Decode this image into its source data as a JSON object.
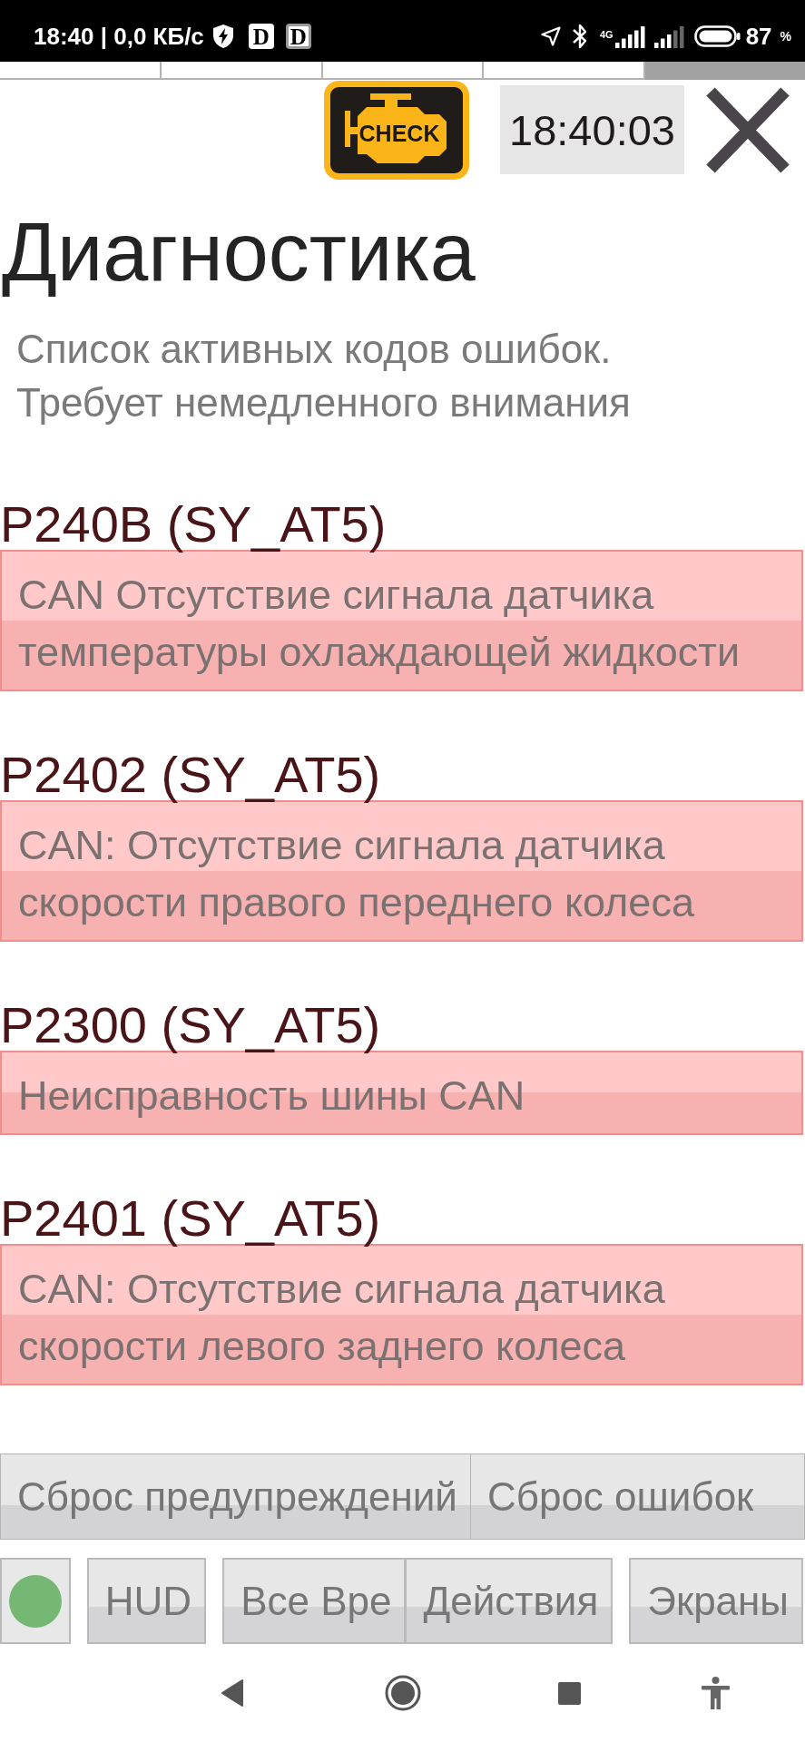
{
  "status_bar": {
    "time_and_speed": "18:40 | 0,0 КБ/с",
    "app_logos": [
      "D",
      "D"
    ],
    "network_type": "4G",
    "battery": "87",
    "battery_unit": "%"
  },
  "pager": [
    {
      "selected": false
    },
    {
      "selected": false
    },
    {
      "selected": false
    },
    {
      "selected": false
    },
    {
      "selected": true
    }
  ],
  "toolbar": {
    "check_engine": {
      "label": "CHECK"
    },
    "clock": "18:40:03"
  },
  "title": "Диагностика",
  "subtitle": "Список активных кодов ошибок. Требует немедленного внимания",
  "errors": [
    {
      "code": "P240B (SY_AT5)",
      "description": "CAN Отсутствие сигнала датчика температуры охлаждающей жидкости"
    },
    {
      "code": "P2402 (SY_AT5)",
      "description": "CAN: Отсутствие сигнала датчика скорости правого переднего колеса"
    },
    {
      "code": "P2300 (SY_AT5)",
      "description": "Неисправность шины CAN"
    },
    {
      "code": "P2401 (SY_AT5)",
      "description": "CAN: Отсутствие сигнала датчика скорости левого заднего колеса"
    }
  ],
  "actions": [
    {
      "label": "Сброс предупреждений"
    },
    {
      "label": "Сброс ошибок"
    }
  ],
  "bottom_bar": [
    {
      "kind": "status",
      "color": "#74b874"
    },
    {
      "kind": "button",
      "label": "HUD"
    },
    {
      "kind": "button",
      "label": "Все Вре"
    },
    {
      "kind": "button",
      "label": "Действия"
    },
    {
      "kind": "button",
      "label": "Экраны"
    }
  ]
}
